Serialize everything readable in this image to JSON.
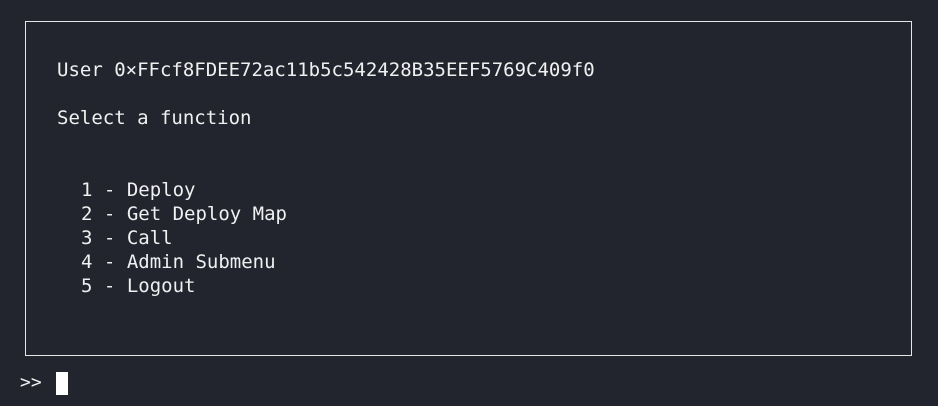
{
  "panel": {
    "user_label": "User",
    "user_address": "0×FFcf8FDEE72ac11b5c542428B35EEF5769C409f0",
    "prompt": "Select a function",
    "menu": [
      {
        "number": "1",
        "separator": "-",
        "label": "Deploy"
      },
      {
        "number": "2",
        "separator": "-",
        "label": "Get Deploy Map"
      },
      {
        "number": "3",
        "separator": "-",
        "label": "Call"
      },
      {
        "number": "4",
        "separator": "-",
        "label": "Admin Submenu"
      },
      {
        "number": "5",
        "separator": "-",
        "label": "Logout"
      }
    ]
  },
  "input": {
    "prompt_symbol": ">>",
    "value": ""
  },
  "colors": {
    "background": "#22252e",
    "text": "#f0f0f0",
    "border": "#e6e6e6",
    "cursor": "#ffffff"
  }
}
